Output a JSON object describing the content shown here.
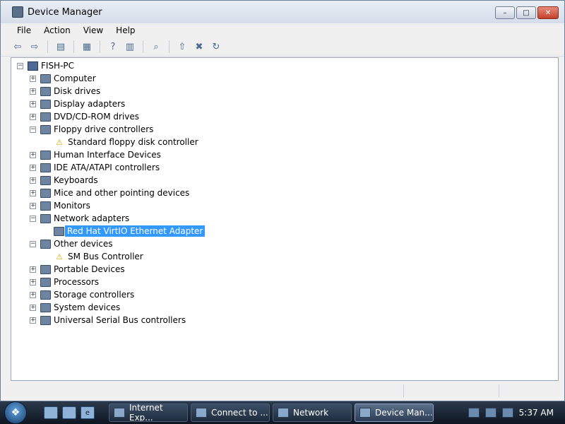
{
  "window": {
    "title": "Device Manager",
    "icon": "device-manager-icon"
  },
  "menu": [
    "File",
    "Action",
    "View",
    "Help"
  ],
  "toolbar": [
    "back-icon",
    "forward-icon",
    "sep",
    "properties-icon",
    "sep",
    "update-icon",
    "sep",
    "help-icon",
    "view-icon",
    "sep",
    "scan-icon",
    "sep",
    "update-driver-icon",
    "uninstall-icon",
    "enable-icon"
  ],
  "tree": {
    "root": "FISH-PC",
    "nodes": [
      {
        "label": "Computer",
        "expanded": false
      },
      {
        "label": "Disk drives",
        "expanded": false
      },
      {
        "label": "Display adapters",
        "expanded": false
      },
      {
        "label": "DVD/CD-ROM drives",
        "expanded": false
      },
      {
        "label": "Floppy drive controllers",
        "expanded": true
      },
      {
        "label": "Standard floppy disk controller",
        "child": true,
        "warn": true
      },
      {
        "label": "Human Interface Devices",
        "expanded": false
      },
      {
        "label": "IDE ATA/ATAPI controllers",
        "expanded": false
      },
      {
        "label": "Keyboards",
        "expanded": false
      },
      {
        "label": "Mice and other pointing devices",
        "expanded": false
      },
      {
        "label": "Monitors",
        "expanded": false
      },
      {
        "label": "Network adapters",
        "expanded": true
      },
      {
        "label": "Red Hat VirtIO Ethernet Adapter",
        "child": true,
        "selected": true
      },
      {
        "label": "Other devices",
        "expanded": true
      },
      {
        "label": "SM Bus Controller",
        "child": true,
        "warn": true
      },
      {
        "label": "Portable Devices",
        "expanded": false
      },
      {
        "label": "Processors",
        "expanded": false
      },
      {
        "label": "Storage controllers",
        "expanded": false
      },
      {
        "label": "System devices",
        "expanded": false
      },
      {
        "label": "Universal Serial Bus controllers",
        "expanded": false
      }
    ]
  },
  "taskbar": {
    "tasks": [
      {
        "label": "Internet Exp...",
        "active": false
      },
      {
        "label": "Connect to ...",
        "active": false
      },
      {
        "label": "Network",
        "active": false
      },
      {
        "label": "Device Man...",
        "active": true
      }
    ],
    "clock": "5:37 AM"
  }
}
